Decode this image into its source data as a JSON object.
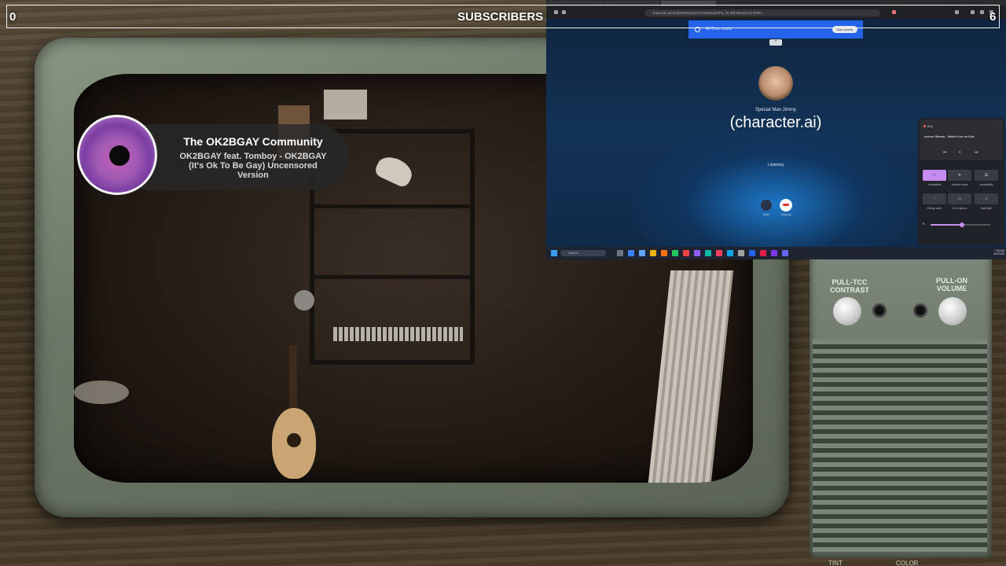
{
  "overlay": {
    "subscribers_label": "SUBSCRIBERS",
    "count_left": "0",
    "count_right": "6"
  },
  "now_playing": {
    "title": "The OK2BGAY Community",
    "subtitle": "OK2BGAY feat. Tomboy - OK2BGAY (It's Ok To Be Gay) Uncensored Version"
  },
  "tv_panel": {
    "contrast_label": "PULL-TCC CONTRAST",
    "volume_label": "PULL-ON VOLUME",
    "tint_label": "TINT",
    "color_label": "COLOR"
  },
  "browser": {
    "url": "character.ai/chat/8PIN52qOOUTWdrbs4IDP4_OI-3hF0BxiOxu3-IDWU",
    "banner_text": "All-Time charts",
    "banner_button": "Start quietly",
    "collapse_glyph": "^"
  },
  "call": {
    "character_name": "Special Man Jimmy",
    "brand": "(character.ai)",
    "status": "Listening",
    "mute_label": "Mute",
    "hangup_label": "Hang up"
  },
  "quick_settings": {
    "media_app": "Kick",
    "media_title": "connor Stream - Watch Live on Kick",
    "prev": "⏮",
    "pause": "⏸",
    "next": "⏭",
    "tiles": [
      {
        "glyph": "‹ ›",
        "label": "Unavailable"
      },
      {
        "glyph": "✈",
        "label": "Airplane mode"
      },
      {
        "glyph": "☰",
        "label": "Accessibility"
      },
      {
        "glyph": "♡",
        "label": "Energy saver"
      },
      {
        "glyph": "▭",
        "label": "Live captions"
      },
      {
        "glyph": "☼",
        "label": "Night light"
      }
    ],
    "volume_fraction": 0.52
  },
  "taskbar": {
    "search": "Search",
    "time": "7:36 AM",
    "date": "6/4/2025"
  },
  "colors": {
    "accent_blue": "#2563eb",
    "qs_accent": "#c68cf0",
    "overlay_text": "#ffffff"
  }
}
